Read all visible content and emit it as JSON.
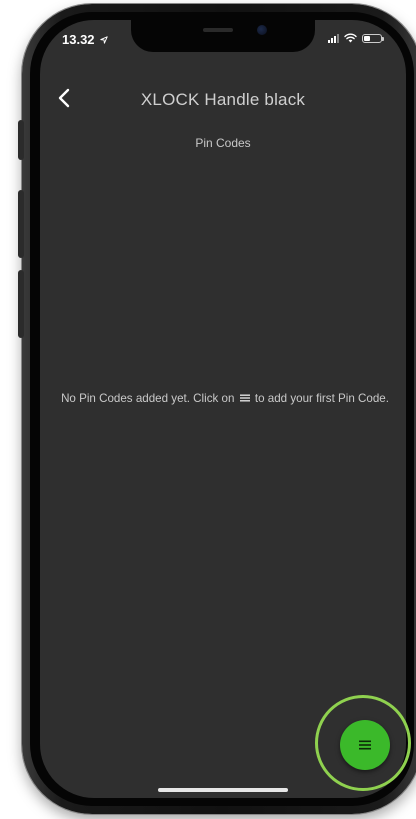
{
  "status_bar": {
    "time": "13.32"
  },
  "header": {
    "title": "XLOCK Handle black",
    "subtitle": "Pin Codes"
  },
  "empty_state": {
    "text_before_icon": "No Pin Codes added yet. Click on",
    "text_after_icon": "to add your first Pin Code."
  },
  "colors": {
    "screen_background": "#2f2f2f",
    "fab_background": "#3bb92a",
    "highlight_ring": "#8fd14f",
    "text": "#c9c9c9"
  },
  "icons": {
    "back": "chevron-left-icon",
    "fab": "menu-icon",
    "inline": "menu-icon",
    "status_location": "location-arrow-icon",
    "status_signal": "signal-icon",
    "status_wifi": "wifi-icon",
    "status_battery": "battery-icon"
  }
}
